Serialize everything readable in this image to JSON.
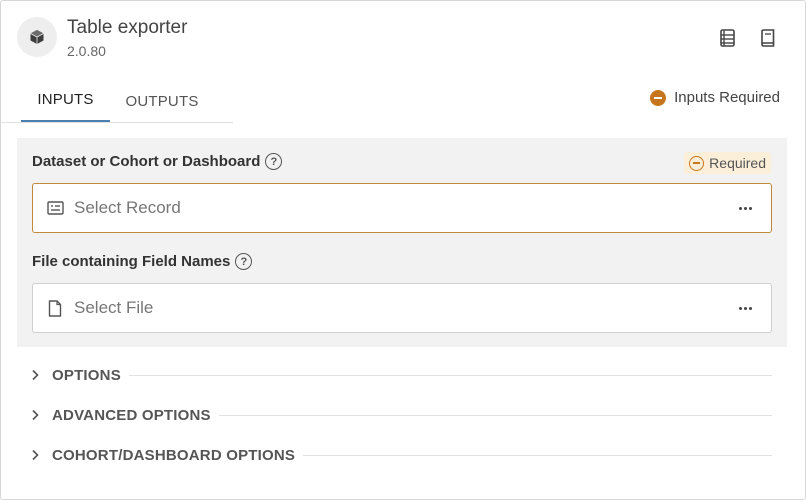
{
  "app": {
    "title": "Table exporter",
    "version": "2.0.80",
    "icon": "cube-icon"
  },
  "header_actions": [
    {
      "icon": "list-document-icon"
    },
    {
      "icon": "book-icon"
    }
  ],
  "tabs": [
    {
      "label": "INPUTS",
      "active": true
    },
    {
      "label": "OUTPUTS",
      "active": false
    }
  ],
  "status": {
    "label": "Inputs Required",
    "color": "#c8761e"
  },
  "inputs": {
    "fields": [
      {
        "label": "Dataset or Cohort or Dashboard",
        "badge": "Required",
        "placeholder": "Select Record",
        "icon": "record-card-icon"
      },
      {
        "label": "File containing Field Names",
        "placeholder": "Select File",
        "icon": "file-icon"
      }
    ]
  },
  "sections": [
    {
      "label": "OPTIONS"
    },
    {
      "label": "ADVANCED OPTIONS"
    },
    {
      "label": "COHORT/DASHBOARD OPTIONS"
    }
  ],
  "colors": {
    "accent_tab": "#4a7fb0",
    "required": "#c8761e",
    "panel_bg": "#f2f2f2"
  }
}
